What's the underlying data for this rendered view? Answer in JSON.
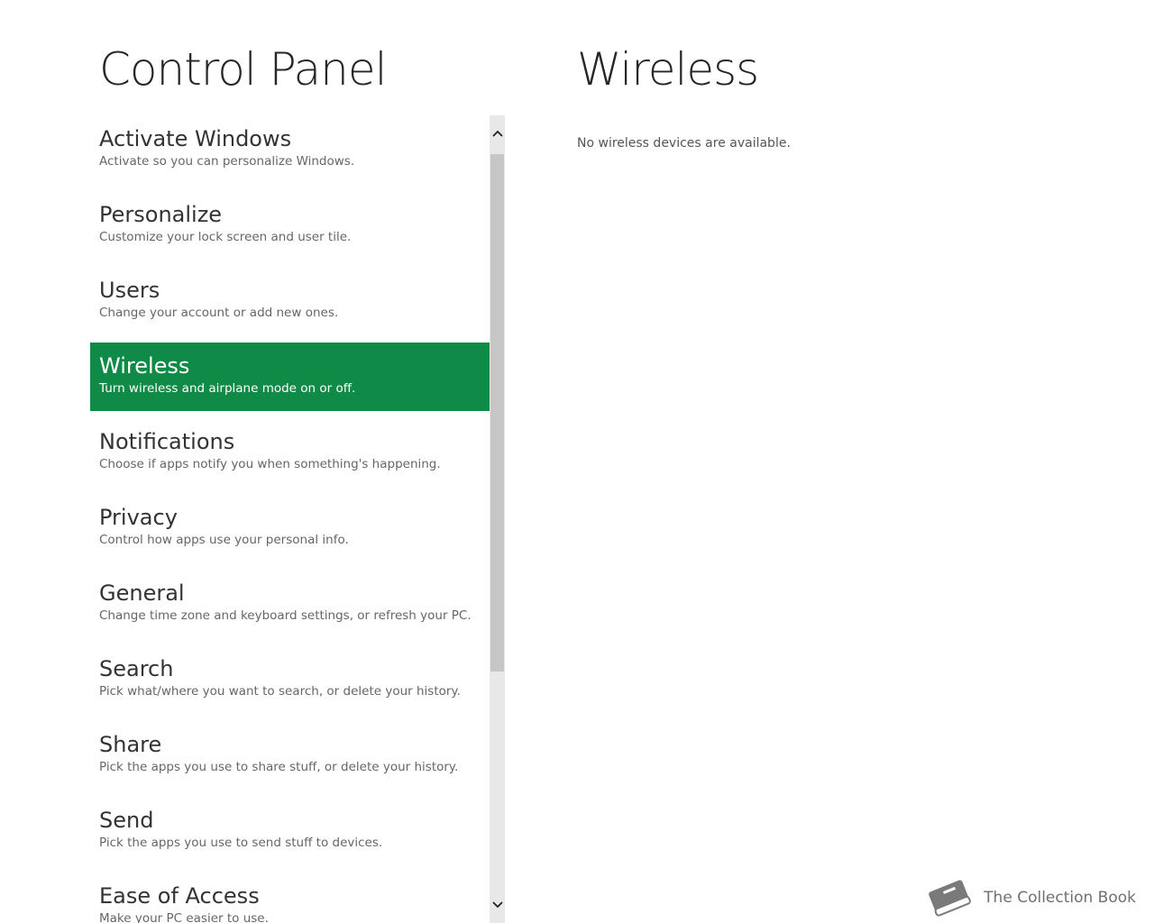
{
  "left_panel": {
    "title": "Control Panel",
    "items": [
      {
        "label": "Activate Windows",
        "description": "Activate so you can personalize Windows."
      },
      {
        "label": "Personalize",
        "description": "Customize your lock screen and user tile."
      },
      {
        "label": "Users",
        "description": "Change your account or add new ones."
      },
      {
        "label": "Wireless",
        "description": "Turn wireless and airplane mode on or off."
      },
      {
        "label": "Notifications",
        "description": "Choose if apps notify you when something's happening."
      },
      {
        "label": "Privacy",
        "description": "Control how apps use your personal info."
      },
      {
        "label": "General",
        "description": "Change time zone and keyboard settings, or refresh your PC."
      },
      {
        "label": "Search",
        "description": "Pick what/where you want to search, or delete your history."
      },
      {
        "label": "Share",
        "description": "Pick the apps you use to share stuff, or delete your history."
      },
      {
        "label": "Send",
        "description": "Pick the apps you use to send stuff to devices."
      },
      {
        "label": "Ease of Access",
        "description": "Make your PC easier to use."
      }
    ],
    "selected_index": 3
  },
  "scrollbar": {
    "up_icon": "chevron-up-icon",
    "down_icon": "chevron-down-icon",
    "up_glyph": "⌃",
    "down_glyph": "⌄"
  },
  "detail": {
    "title": "Wireless",
    "message": "No wireless devices are available."
  },
  "watermark": {
    "text": "The Collection Book",
    "icon": "book-icon"
  },
  "colors": {
    "accent": "#108a47",
    "scroll_track": "#e8e8e8",
    "scroll_thumb": "#c6c6c6"
  }
}
